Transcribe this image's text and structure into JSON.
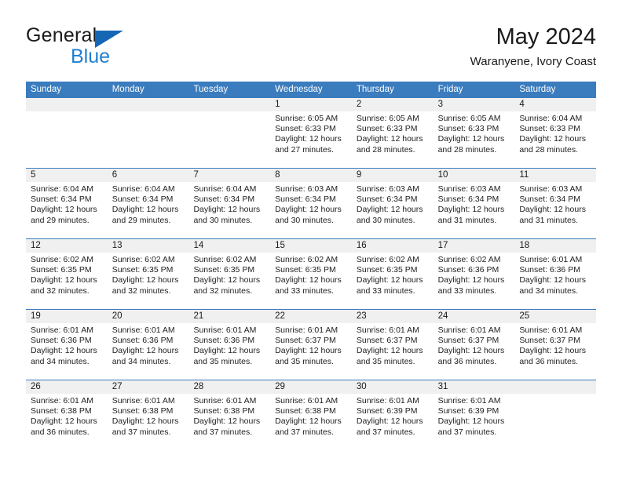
{
  "brand": {
    "name_part1": "General",
    "name_part2": "Blue",
    "accent_color": "#1f7fd0",
    "triangle_color": "#1567b5"
  },
  "header": {
    "title": "May 2024",
    "subtitle": "Waranyene, Ivory Coast"
  },
  "calendar": {
    "header_bg": "#3a7cbe",
    "daynum_bg": "#f0f0f0",
    "weekdays": [
      "Sunday",
      "Monday",
      "Tuesday",
      "Wednesday",
      "Thursday",
      "Friday",
      "Saturday"
    ],
    "weeks": [
      {
        "days": [
          {
            "num": "",
            "lines": []
          },
          {
            "num": "",
            "lines": []
          },
          {
            "num": "",
            "lines": []
          },
          {
            "num": "1",
            "lines": [
              "Sunrise: 6:05 AM",
              "Sunset: 6:33 PM",
              "Daylight: 12 hours",
              "and 27 minutes."
            ]
          },
          {
            "num": "2",
            "lines": [
              "Sunrise: 6:05 AM",
              "Sunset: 6:33 PM",
              "Daylight: 12 hours",
              "and 28 minutes."
            ]
          },
          {
            "num": "3",
            "lines": [
              "Sunrise: 6:05 AM",
              "Sunset: 6:33 PM",
              "Daylight: 12 hours",
              "and 28 minutes."
            ]
          },
          {
            "num": "4",
            "lines": [
              "Sunrise: 6:04 AM",
              "Sunset: 6:33 PM",
              "Daylight: 12 hours",
              "and 28 minutes."
            ]
          }
        ]
      },
      {
        "days": [
          {
            "num": "5",
            "lines": [
              "Sunrise: 6:04 AM",
              "Sunset: 6:34 PM",
              "Daylight: 12 hours",
              "and 29 minutes."
            ]
          },
          {
            "num": "6",
            "lines": [
              "Sunrise: 6:04 AM",
              "Sunset: 6:34 PM",
              "Daylight: 12 hours",
              "and 29 minutes."
            ]
          },
          {
            "num": "7",
            "lines": [
              "Sunrise: 6:04 AM",
              "Sunset: 6:34 PM",
              "Daylight: 12 hours",
              "and 30 minutes."
            ]
          },
          {
            "num": "8",
            "lines": [
              "Sunrise: 6:03 AM",
              "Sunset: 6:34 PM",
              "Daylight: 12 hours",
              "and 30 minutes."
            ]
          },
          {
            "num": "9",
            "lines": [
              "Sunrise: 6:03 AM",
              "Sunset: 6:34 PM",
              "Daylight: 12 hours",
              "and 30 minutes."
            ]
          },
          {
            "num": "10",
            "lines": [
              "Sunrise: 6:03 AM",
              "Sunset: 6:34 PM",
              "Daylight: 12 hours",
              "and 31 minutes."
            ]
          },
          {
            "num": "11",
            "lines": [
              "Sunrise: 6:03 AM",
              "Sunset: 6:34 PM",
              "Daylight: 12 hours",
              "and 31 minutes."
            ]
          }
        ]
      },
      {
        "days": [
          {
            "num": "12",
            "lines": [
              "Sunrise: 6:02 AM",
              "Sunset: 6:35 PM",
              "Daylight: 12 hours",
              "and 32 minutes."
            ]
          },
          {
            "num": "13",
            "lines": [
              "Sunrise: 6:02 AM",
              "Sunset: 6:35 PM",
              "Daylight: 12 hours",
              "and 32 minutes."
            ]
          },
          {
            "num": "14",
            "lines": [
              "Sunrise: 6:02 AM",
              "Sunset: 6:35 PM",
              "Daylight: 12 hours",
              "and 32 minutes."
            ]
          },
          {
            "num": "15",
            "lines": [
              "Sunrise: 6:02 AM",
              "Sunset: 6:35 PM",
              "Daylight: 12 hours",
              "and 33 minutes."
            ]
          },
          {
            "num": "16",
            "lines": [
              "Sunrise: 6:02 AM",
              "Sunset: 6:35 PM",
              "Daylight: 12 hours",
              "and 33 minutes."
            ]
          },
          {
            "num": "17",
            "lines": [
              "Sunrise: 6:02 AM",
              "Sunset: 6:36 PM",
              "Daylight: 12 hours",
              "and 33 minutes."
            ]
          },
          {
            "num": "18",
            "lines": [
              "Sunrise: 6:01 AM",
              "Sunset: 6:36 PM",
              "Daylight: 12 hours",
              "and 34 minutes."
            ]
          }
        ]
      },
      {
        "days": [
          {
            "num": "19",
            "lines": [
              "Sunrise: 6:01 AM",
              "Sunset: 6:36 PM",
              "Daylight: 12 hours",
              "and 34 minutes."
            ]
          },
          {
            "num": "20",
            "lines": [
              "Sunrise: 6:01 AM",
              "Sunset: 6:36 PM",
              "Daylight: 12 hours",
              "and 34 minutes."
            ]
          },
          {
            "num": "21",
            "lines": [
              "Sunrise: 6:01 AM",
              "Sunset: 6:36 PM",
              "Daylight: 12 hours",
              "and 35 minutes."
            ]
          },
          {
            "num": "22",
            "lines": [
              "Sunrise: 6:01 AM",
              "Sunset: 6:37 PM",
              "Daylight: 12 hours",
              "and 35 minutes."
            ]
          },
          {
            "num": "23",
            "lines": [
              "Sunrise: 6:01 AM",
              "Sunset: 6:37 PM",
              "Daylight: 12 hours",
              "and 35 minutes."
            ]
          },
          {
            "num": "24",
            "lines": [
              "Sunrise: 6:01 AM",
              "Sunset: 6:37 PM",
              "Daylight: 12 hours",
              "and 36 minutes."
            ]
          },
          {
            "num": "25",
            "lines": [
              "Sunrise: 6:01 AM",
              "Sunset: 6:37 PM",
              "Daylight: 12 hours",
              "and 36 minutes."
            ]
          }
        ]
      },
      {
        "days": [
          {
            "num": "26",
            "lines": [
              "Sunrise: 6:01 AM",
              "Sunset: 6:38 PM",
              "Daylight: 12 hours",
              "and 36 minutes."
            ]
          },
          {
            "num": "27",
            "lines": [
              "Sunrise: 6:01 AM",
              "Sunset: 6:38 PM",
              "Daylight: 12 hours",
              "and 37 minutes."
            ]
          },
          {
            "num": "28",
            "lines": [
              "Sunrise: 6:01 AM",
              "Sunset: 6:38 PM",
              "Daylight: 12 hours",
              "and 37 minutes."
            ]
          },
          {
            "num": "29",
            "lines": [
              "Sunrise: 6:01 AM",
              "Sunset: 6:38 PM",
              "Daylight: 12 hours",
              "and 37 minutes."
            ]
          },
          {
            "num": "30",
            "lines": [
              "Sunrise: 6:01 AM",
              "Sunset: 6:39 PM",
              "Daylight: 12 hours",
              "and 37 minutes."
            ]
          },
          {
            "num": "31",
            "lines": [
              "Sunrise: 6:01 AM",
              "Sunset: 6:39 PM",
              "Daylight: 12 hours",
              "and 37 minutes."
            ]
          },
          {
            "num": "",
            "lines": []
          }
        ]
      }
    ]
  }
}
